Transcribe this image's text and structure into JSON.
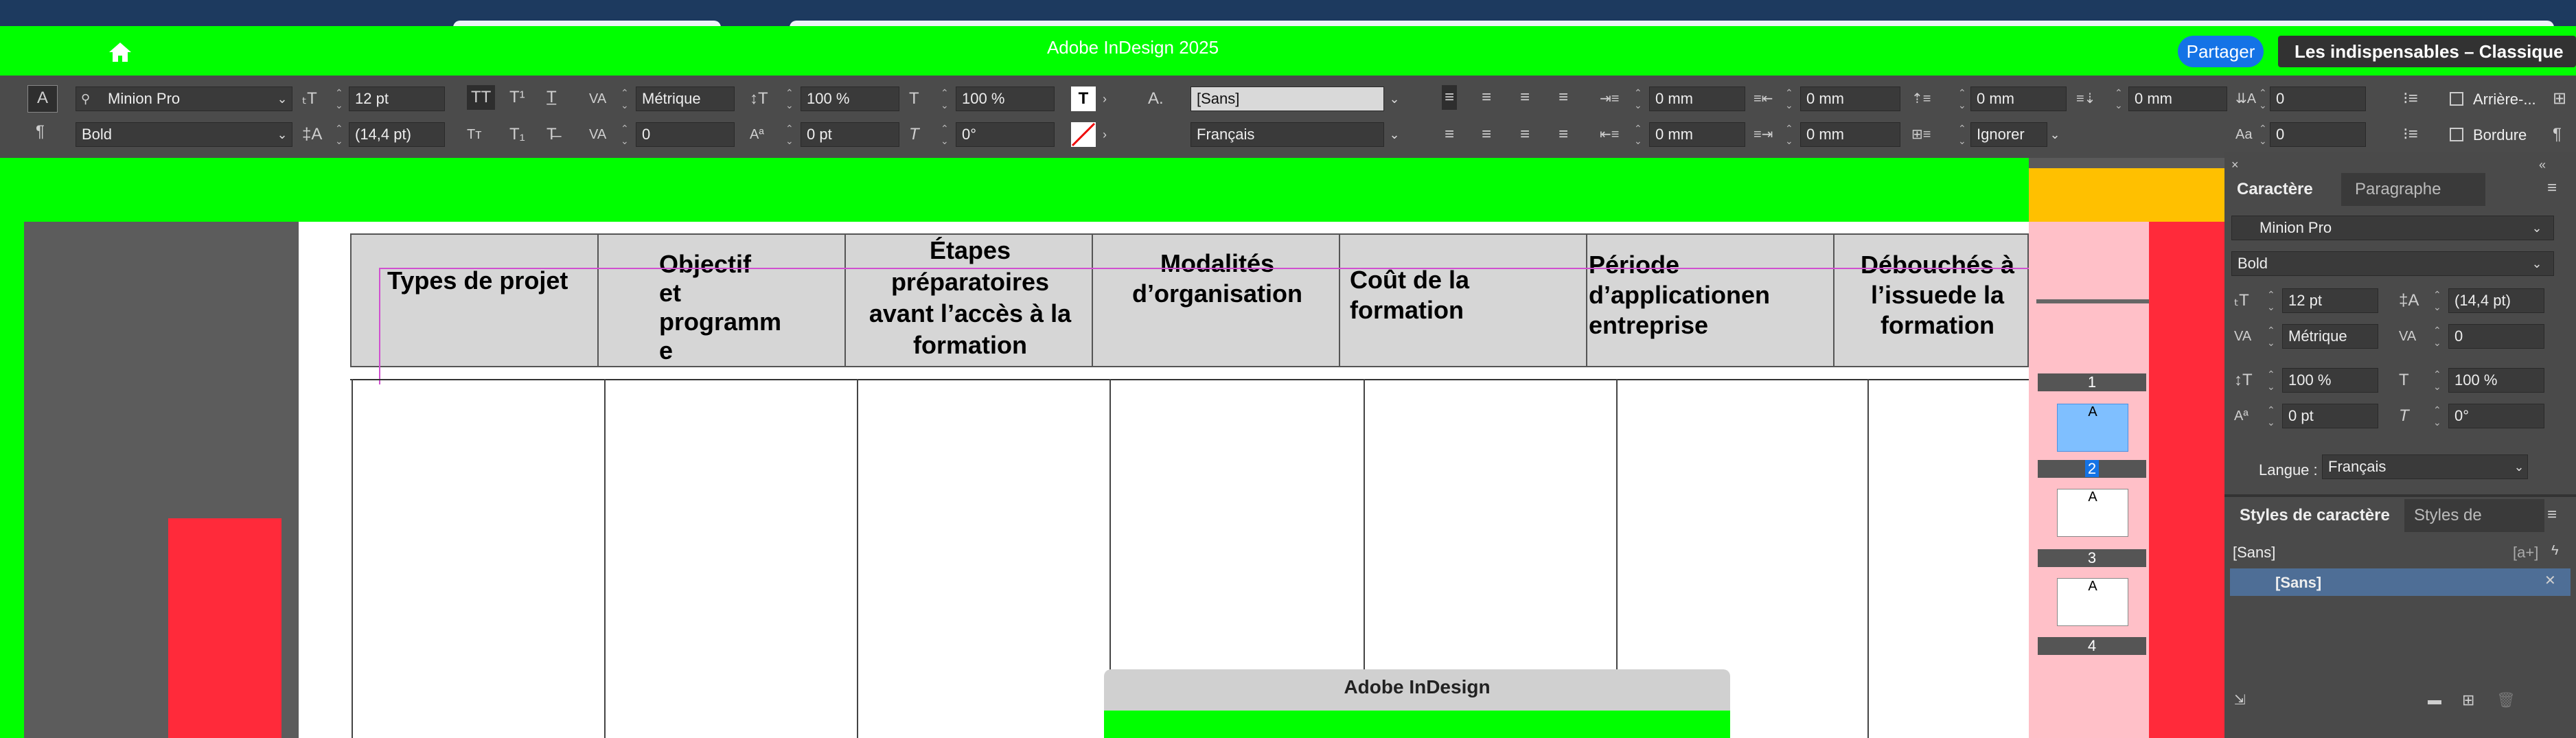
{
  "window": {
    "title": "Adobe InDesign 2025"
  },
  "header": {
    "share_label": "Partager",
    "workspace_label": "Les indispensables – Classique"
  },
  "control_bar": {
    "font_family": "Minion Pro",
    "font_style": "Bold",
    "font_size": "12 pt",
    "leading": "(14,4 pt)",
    "kerning": "Métrique",
    "tracking": "0",
    "vertical_scale": "100 %",
    "horizontal_scale": "100 %",
    "baseline_shift": "0 pt",
    "skew": "0°",
    "character_style": "[Sans]",
    "language": "Français",
    "left_indent": "0 mm",
    "right_indent": "0 mm",
    "first_line_indent": "0 mm",
    "last_line_indent": "0 mm",
    "space_before": "0 mm",
    "space_after": "0 mm",
    "align_grid": "Ignorer",
    "dropcap_lines": "0",
    "dropcap_chars": "0",
    "shading_label": "Arrière-...",
    "border_label": "Bordure"
  },
  "table": {
    "headers": [
      "Types de projet",
      "Objectif\net\nprogramm\ne",
      "Étapes\npréparatoires\navant l’accès à la\nformation",
      "Modalités\nd’organisation",
      "Coût de la\nformation",
      "Période\nd’applicationen\nentreprise",
      "Débouchés à\nl’issuede la\nformation"
    ]
  },
  "pages_panel": {
    "pages": [
      "1",
      "2",
      "3",
      "4"
    ],
    "master_label": "A"
  },
  "character_panel": {
    "tabs": [
      "Caractère",
      "Paragraphe"
    ],
    "font_family": "Minion Pro",
    "font_style": "Bold",
    "font_size": "12 pt",
    "leading": "(14,4 pt)",
    "kerning": "Métrique",
    "tracking": "0",
    "vertical_scale": "100 %",
    "horizontal_scale": "100 %",
    "baseline_shift": "0 pt",
    "skew": "0°",
    "language_label": "Langue :",
    "language": "Français"
  },
  "char_styles_panel": {
    "tabs": [
      "Styles de caractère",
      "Styles de"
    ],
    "header_item": "[Sans]",
    "new_badge": "[a+]",
    "selected_item": "[Sans]"
  },
  "dialog": {
    "title": "Adobe InDesign"
  },
  "colors": {
    "accent_green": "#00ff00",
    "share_blue": "#1473e6",
    "overlay_red": "#ff2a3a",
    "overlay_orange": "#ffc000",
    "overlay_pink": "#ffc0c8"
  }
}
